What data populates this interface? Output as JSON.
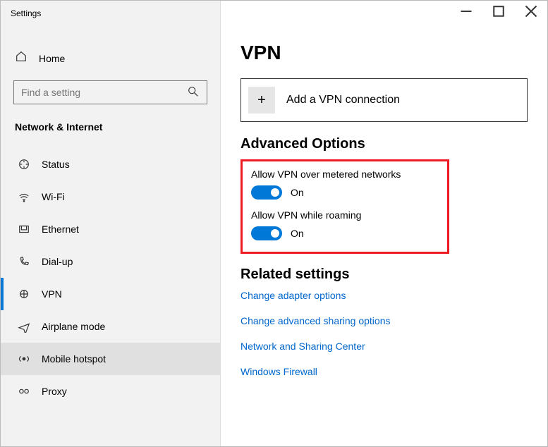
{
  "titlebar": "Settings",
  "home_label": "Home",
  "search_placeholder": "Find a setting",
  "section_label": "Network & Internet",
  "nav": [
    {
      "label": "Status"
    },
    {
      "label": "Wi-Fi"
    },
    {
      "label": "Ethernet"
    },
    {
      "label": "Dial-up"
    },
    {
      "label": "VPN"
    },
    {
      "label": "Airplane mode"
    },
    {
      "label": "Mobile hotspot"
    },
    {
      "label": "Proxy"
    }
  ],
  "page_title": "VPN",
  "add_vpn_label": "Add a VPN connection",
  "advanced_heading": "Advanced Options",
  "toggle1_label": "Allow VPN over metered networks",
  "toggle1_state": "On",
  "toggle2_label": "Allow VPN while roaming",
  "toggle2_state": "On",
  "related_heading": "Related settings",
  "links": [
    "Change adapter options",
    "Change advanced sharing options",
    "Network and Sharing Center",
    "Windows Firewall"
  ]
}
